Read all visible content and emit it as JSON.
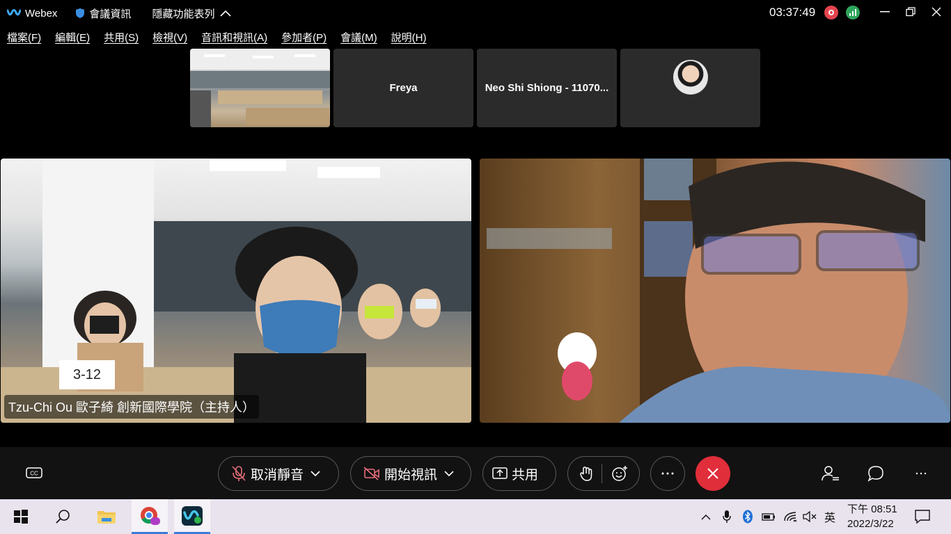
{
  "titlebar": {
    "app_name": "Webex",
    "meeting_info": "會議資訊",
    "hide_menu": "隱藏功能表列",
    "clock": "03:37:49"
  },
  "menu": [
    "檔案(F)",
    "編輯(E)",
    "共用(S)",
    "檢視(V)",
    "音訊和視訊(A)",
    "參加者(P)",
    "會議(M)",
    "說明(H)"
  ],
  "thumbnails": [
    {
      "name": ""
    },
    {
      "name": "Freya"
    },
    {
      "name": "Neo Shi Shiong - 11070..."
    },
    {
      "name": ""
    }
  ],
  "main": {
    "left_name": "Tzu-Chi Ou 歐子綺 創新國際學院（主持人）",
    "left_placard": "3-12"
  },
  "controls": {
    "unmute": "取消靜音",
    "start_video": "開始視訊",
    "share": "共用"
  },
  "taskbar": {
    "input_lang": "英",
    "time": "下午 08:51",
    "date": "2022/3/22"
  },
  "colors": {
    "end_call": "#e02e3b",
    "record": "#e6444d",
    "stats": "#2ea55b"
  }
}
